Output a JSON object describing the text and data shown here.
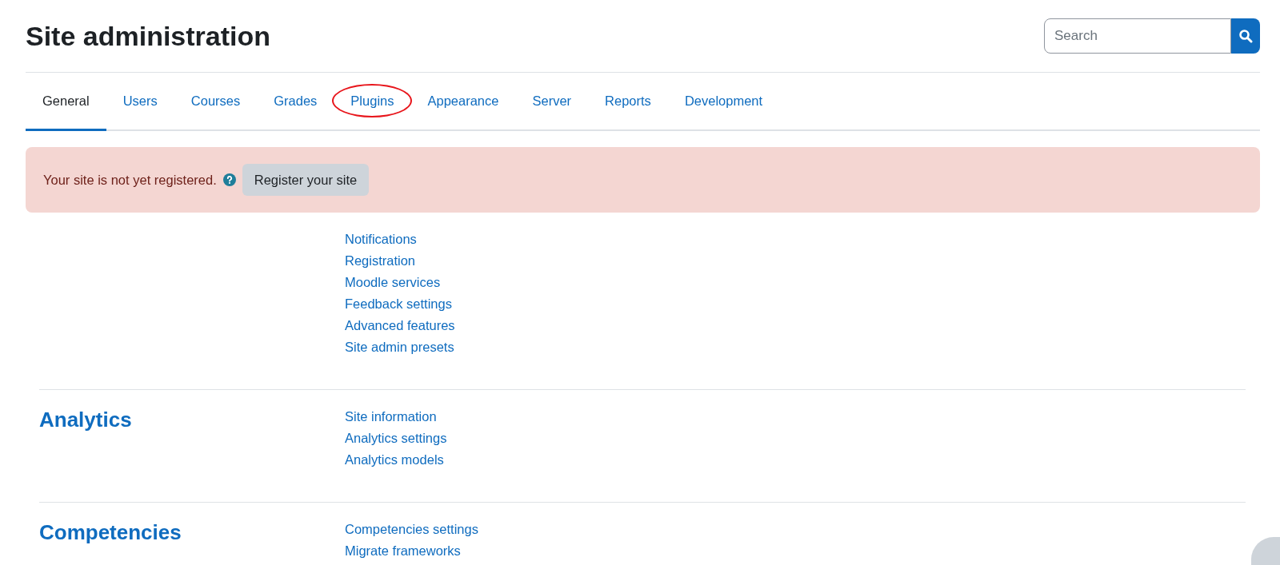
{
  "page_title": "Site administration",
  "search": {
    "placeholder": "Search"
  },
  "tabs": [
    {
      "label": "General",
      "selected": true,
      "highlighted": false
    },
    {
      "label": "Users",
      "selected": false,
      "highlighted": false
    },
    {
      "label": "Courses",
      "selected": false,
      "highlighted": false
    },
    {
      "label": "Grades",
      "selected": false,
      "highlighted": false
    },
    {
      "label": "Plugins",
      "selected": false,
      "highlighted": true
    },
    {
      "label": "Appearance",
      "selected": false,
      "highlighted": false
    },
    {
      "label": "Server",
      "selected": false,
      "highlighted": false
    },
    {
      "label": "Reports",
      "selected": false,
      "highlighted": false
    },
    {
      "label": "Development",
      "selected": false,
      "highlighted": false
    }
  ],
  "alert": {
    "message": "Your site is not yet registered.",
    "button": "Register your site"
  },
  "sections": [
    {
      "links": [
        "Notifications",
        "Registration",
        "Moodle services",
        "Feedback settings",
        "Advanced features",
        "Site admin presets"
      ]
    },
    {
      "heading": "Analytics",
      "links": [
        "Site information",
        "Analytics settings",
        "Analytics models"
      ]
    },
    {
      "heading": "Competencies",
      "links": [
        "Competencies settings",
        "Migrate frameworks"
      ]
    }
  ]
}
